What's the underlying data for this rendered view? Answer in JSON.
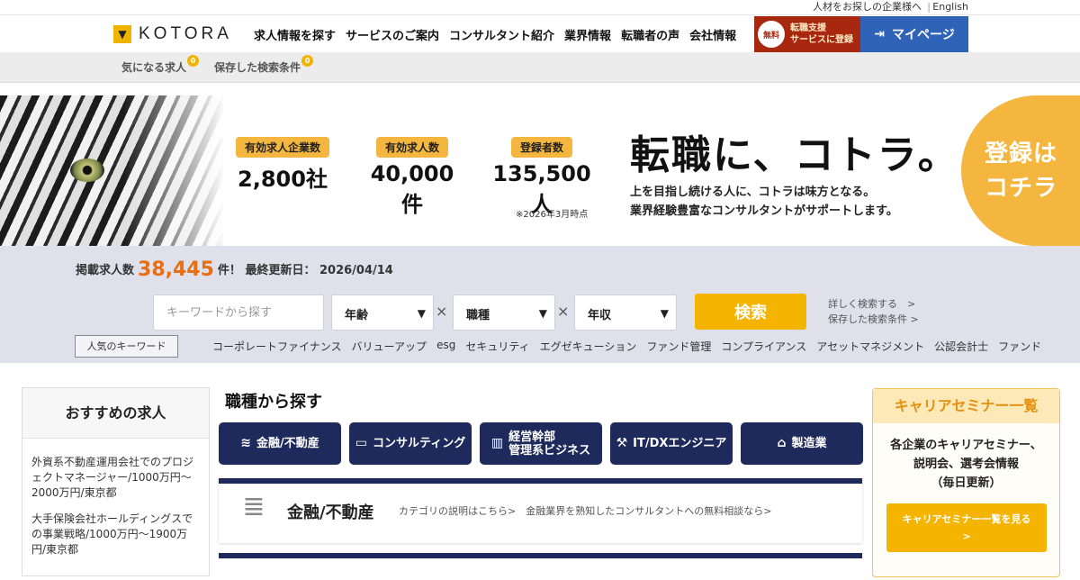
{
  "topbar": {
    "corp_link": "人材をお探しの企業様へ",
    "separator": "|",
    "english_link": "English"
  },
  "header": {
    "logo_text": "KOTORA",
    "nav": [
      "求人情報を探す",
      "サービスのご案内",
      "コンサルタント紹介",
      "業界情報",
      "転職者の声",
      "会社情報"
    ],
    "free_badge": "無料",
    "free_label_1": "転職支援",
    "free_label_2": "サービスに登録",
    "mypage_label": "マイページ"
  },
  "subbar": {
    "fav_label": "気になる求人",
    "fav_count": "0",
    "saved_label": "保存した検索条件",
    "saved_count": "0"
  },
  "hero": {
    "stats": [
      {
        "label": "有効求人企業数",
        "value": "2,800社"
      },
      {
        "label": "有効求人数",
        "value": "40,000件"
      },
      {
        "label": "登録者数",
        "value": "135,500人"
      }
    ],
    "as_of": "※2026年3月時点",
    "title": "転職に、コトラ。",
    "sub_1": "上を目指し続ける人に、コトラは味方となる。",
    "sub_2": "業界経験豊富なコンサルタントがサポートします。",
    "register_1": "登録は",
    "register_2": "コチラ"
  },
  "search": {
    "count_prefix": "掲載求人数",
    "count_value": "38,445",
    "count_suffix": "件！ 最終更新日： 2026/04/14",
    "keyword_placeholder": "キーワードから探す",
    "age": "年齢",
    "job_type": "職種",
    "income": "年収",
    "times": "×",
    "button": "検索",
    "advanced": "詳しく検索する　>",
    "saved": "保存した検索条件 >",
    "popular_label": "人気のキーワード",
    "keywords": [
      "コーポレートファイナンス",
      "バリューアップ",
      "esg",
      "セキュリティ",
      "エグゼキューション",
      "ファンド管理",
      "コンプライアンス",
      "アセットマネジメント",
      "公認会計士",
      "ファンド"
    ]
  },
  "sidebar": {
    "title": "おすすめの求人",
    "jobs": [
      "外資系不動産運用会社でのプロジェクトマネージャー/1000万円〜2000万円/東京都",
      "大手保険会社ホールディングスでの事業戦略/1000万円〜1900万円/東京都"
    ]
  },
  "main": {
    "title": "職種から探す",
    "categories": [
      {
        "label": "金融/不動産",
        "icon": "money-icon"
      },
      {
        "label": "コンサルティング",
        "icon": "monitor-icon"
      },
      {
        "label": "経営幹部\n管理系ビジネス",
        "icon": "chart-icon"
      },
      {
        "label": "IT/DXエンジニア",
        "icon": "tools-icon"
      },
      {
        "label": "製造業",
        "icon": "factory-icon"
      }
    ],
    "panel_title": "金融/不動産",
    "panel_desc": "カテゴリの説明はこちら>　金融業界を熟知したコンサルタントへの無料相談なら>"
  },
  "seminar": {
    "title": "キャリアセミナー一覧",
    "line_1": "各企業のキャリアセミナー、",
    "line_2": "説明会、選考会情報",
    "line_3": "（毎日更新）",
    "button_1": "キャリアセミナー一覧を見る",
    "button_2": ">"
  }
}
